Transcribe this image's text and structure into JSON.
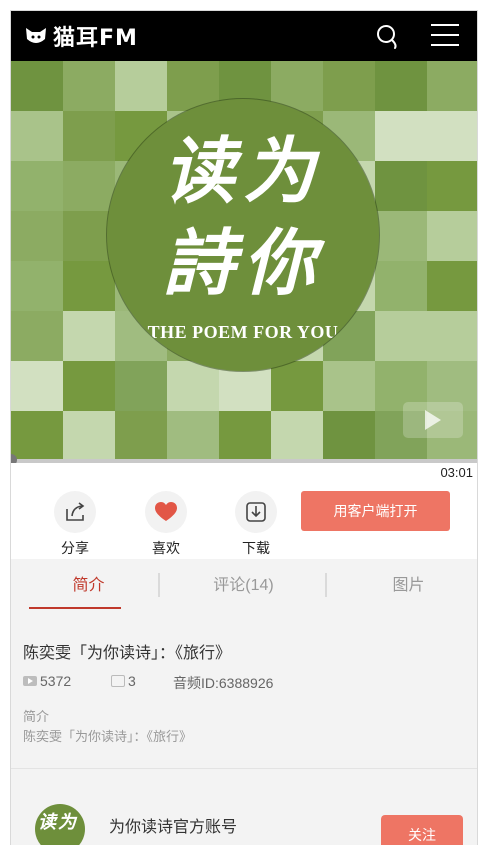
{
  "header": {
    "brand": "猫耳FM",
    "logo_icon": "cat-ear-icon",
    "search_icon": "search-icon",
    "menu_icon": "menu-icon",
    "background": "#000000"
  },
  "cover": {
    "calligraphy_line1": "读为",
    "calligraphy_line2": "詩你",
    "subtitle": "THE POEM FOR YOU",
    "play_icon": "play-icon",
    "primary_color": "#6e8f3b"
  },
  "player": {
    "duration": "03:01",
    "progress_percent": 0
  },
  "actions": {
    "share_label": "分享",
    "share_icon": "share-icon",
    "like_label": "喜欢",
    "like_icon": "heart-icon",
    "download_label": "下载",
    "download_icon": "download-icon",
    "open_app_label": "用客户端打开",
    "accent": "#ee7564",
    "like_color": "#e25646"
  },
  "tabs": [
    {
      "label": "简介",
      "active": true
    },
    {
      "label": "评论(14)",
      "active": false
    },
    {
      "label": "图片",
      "active": false
    }
  ],
  "info": {
    "title": "陈奕雯「为你读诗」：《旅行》",
    "play_count": "5372",
    "comment_count": "3",
    "audio_id": "音频ID:6388926",
    "desc_label": "简介",
    "desc_text": "陈奕雯「为你读诗」：《旅行》"
  },
  "account": {
    "avatar_text": "读为",
    "name": "为你读诗官方账号",
    "follow_label": "关注"
  }
}
